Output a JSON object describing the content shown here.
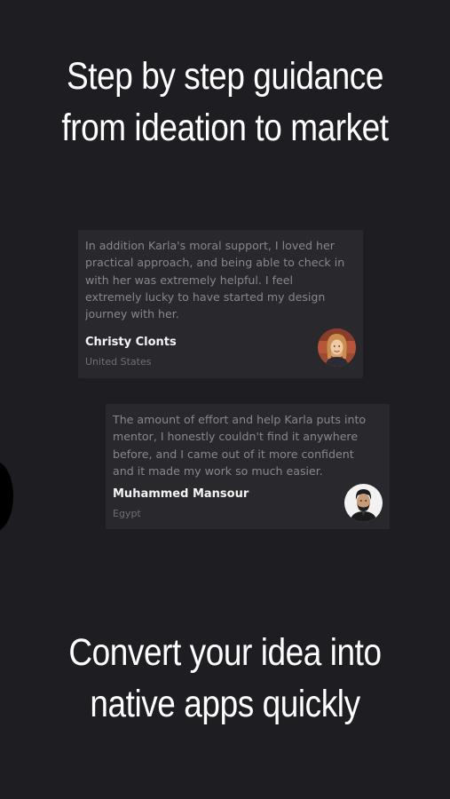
{
  "headline_top": {
    "line1": "Step by step guidance",
    "line2": "from ideation to market"
  },
  "testimonials": [
    {
      "quote_lines": [
        "In addition Karla's moral support, I loved her",
        "practical approach, and being able to check in",
        "with her was extremely helpful. I feel",
        "extremely lucky to have started my design",
        "journey with her."
      ],
      "name": "Christy Clonts",
      "country": "United States",
      "avatar_icon": "woman-portrait-avatar"
    },
    {
      "quote_lines": [
        "The amount of effort and help Karla puts into",
        "mentor, I honestly couldn't find it anywhere",
        "before, and I came out of it more confident",
        "and it made my work so much easier."
      ],
      "name": "Muhammed Mansour",
      "country": "Egypt",
      "avatar_icon": "man-portrait-avatar"
    }
  ],
  "headline_bottom": {
    "line1": "Convert your idea into",
    "line2": "native apps quickly"
  },
  "colors": {
    "background": "#1e1e22",
    "card": "#28282d",
    "quote_text": "#87878c",
    "name_text": "#f4f4f4",
    "headline_text": "#ffffff"
  }
}
